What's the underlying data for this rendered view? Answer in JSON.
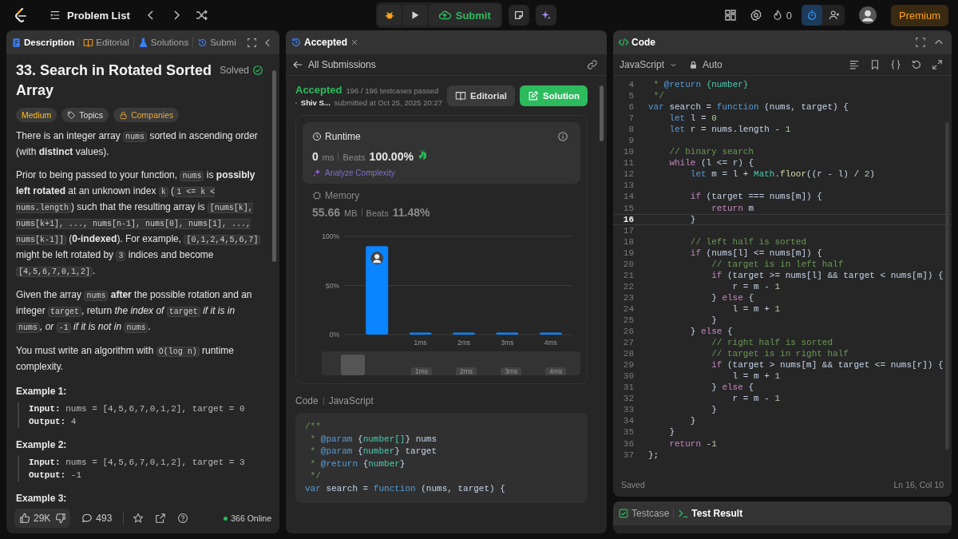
{
  "top_bar": {
    "problem_list": "Problem List",
    "submit": "Submit",
    "fire_count": "0",
    "premium": "Premium"
  },
  "description_panel": {
    "tabs": [
      {
        "label": "Description",
        "selected": true
      },
      {
        "label": "Editorial",
        "selected": false
      },
      {
        "label": "Solutions",
        "selected": false
      },
      {
        "label": "Submi",
        "selected": false
      }
    ],
    "title": "33. Search in Rotated Sorted Array",
    "status": "Solved",
    "tags": [
      {
        "label": "Medium",
        "kind": "difficulty"
      },
      {
        "label": "Topics",
        "kind": "topic"
      },
      {
        "label": "Companies",
        "kind": "company"
      }
    ],
    "paragraphs": [
      [
        {
          "kind": "text",
          "text": "There is an integer array "
        },
        {
          "kind": "code",
          "text": "nums"
        },
        {
          "kind": "text",
          "text": " sorted in ascending order (with **distinct** values)."
        }
      ],
      [
        {
          "kind": "text",
          "text": "Prior to being passed to your function, "
        },
        {
          "kind": "code",
          "text": "nums"
        },
        {
          "kind": "text",
          "text": " is **possibly left rotated** at an unknown index "
        },
        {
          "kind": "code",
          "text": "k"
        },
        {
          "kind": "text",
          "text": " ("
        },
        {
          "kind": "code",
          "text": "1 <= k < nums.length"
        },
        {
          "kind": "text",
          "text": ") such that the resulting array is "
        },
        {
          "kind": "code",
          "text": "[nums[k], nums[k+1], ..., nums[n-1], nums[0], nums[1], ..., nums[k-1]]"
        },
        {
          "kind": "text",
          "text": " (**0-indexed**). For example, "
        },
        {
          "kind": "code",
          "text": "[0,1,2,4,5,6,7]"
        },
        {
          "kind": "text",
          "text": " might be left rotated by "
        },
        {
          "kind": "code",
          "text": "3"
        },
        {
          "kind": "text",
          "text": " indices and become "
        },
        {
          "kind": "code",
          "text": "[4,5,6,7,0,1,2]"
        },
        {
          "kind": "text",
          "text": "."
        }
      ],
      [
        {
          "kind": "text",
          "text": "Given the array "
        },
        {
          "kind": "code",
          "text": "nums"
        },
        {
          "kind": "text",
          "text": " **after** the possible rotation and an integer "
        },
        {
          "kind": "code",
          "text": "target"
        },
        {
          "kind": "text",
          "text": ", return *the index of* "
        },
        {
          "kind": "code",
          "text": "target"
        },
        {
          "kind": "text",
          "text": " *if it is in* "
        },
        {
          "kind": "code",
          "text": "nums"
        },
        {
          "kind": "text",
          "text": "*, or* "
        },
        {
          "kind": "code",
          "text": "-1"
        },
        {
          "kind": "text",
          "text": " *if it is not in* "
        },
        {
          "kind": "code",
          "text": "nums"
        },
        {
          "kind": "text",
          "text": "."
        }
      ],
      [
        {
          "kind": "text",
          "text": "You must write an algorithm with "
        },
        {
          "kind": "code",
          "text": "O(log n)"
        },
        {
          "kind": "text",
          "text": " runtime complexity."
        }
      ]
    ],
    "examples": [
      {
        "title": "Example 1:",
        "lines": [
          {
            "label": "Input:",
            "value": "nums = [4,5,6,7,0,1,2], target = 0"
          },
          {
            "label": "Output:",
            "value": "4"
          }
        ]
      },
      {
        "title": "Example 2:",
        "lines": [
          {
            "label": "Input:",
            "value": "nums = [4,5,6,7,0,1,2], target = 3"
          },
          {
            "label": "Output:",
            "value": "-1"
          }
        ]
      },
      {
        "title": "Example 3:"
      }
    ],
    "footer": {
      "likes": "29K",
      "comments": "493",
      "online": "366 Online"
    }
  },
  "submission_panel": {
    "tab": "Accepted",
    "back": "All Submissions",
    "status": "Accepted",
    "testcases": "196 / 196 testcases passed",
    "user": "Shiv S...",
    "submitted": "submitted at Oct 25, 2025 20:27",
    "buttons": [
      {
        "label": "Editorial",
        "kind": "secondary"
      },
      {
        "label": "Solution",
        "kind": "primary"
      }
    ],
    "runtime": {
      "title": "Runtime",
      "value": "0",
      "unit": "ms",
      "beats_label": "Beats",
      "beats": "100.00%",
      "analyze": "Analyze Complexity",
      "selected": true
    },
    "memory": {
      "title": "Memory",
      "value": "55.66",
      "unit": "MB",
      "beats_label": "Beats",
      "beats": "11.48%",
      "selected": false
    },
    "chart_data": {
      "type": "bar",
      "categories": [
        null,
        "1ms",
        "2ms",
        "3ms",
        "4ms"
      ],
      "values": [
        90,
        2,
        2,
        2,
        2
      ],
      "ylim": [
        0,
        100
      ],
      "yticks": [
        {
          "value": 0,
          "label": "0%"
        },
        {
          "value": 50,
          "label": "50%"
        },
        {
          "value": 100,
          "label": "100%"
        }
      ]
    },
    "navigator": {
      "labels": [
        "1ms",
        "2ms",
        "3ms",
        "4ms"
      ]
    },
    "code_label": "Code",
    "language": "JavaScript",
    "code": [
      {
        "tokens": [
          {
            "text": "/**",
            "kind": "cm"
          }
        ]
      },
      {
        "tokens": [
          {
            "text": " * ",
            "kind": "cm"
          },
          {
            "text": "@param",
            "kind": "doc"
          },
          {
            "text": " {"
          },
          {
            "text": "number[]",
            "kind": "type"
          },
          {
            "text": "} nums"
          }
        ]
      },
      {
        "tokens": [
          {
            "text": " * ",
            "kind": "cm"
          },
          {
            "text": "@param",
            "kind": "doc"
          },
          {
            "text": " {"
          },
          {
            "text": "number",
            "kind": "type"
          },
          {
            "text": "} target"
          }
        ]
      },
      {
        "tokens": [
          {
            "text": " * ",
            "kind": "cm"
          },
          {
            "text": "@return",
            "kind": "doc"
          },
          {
            "text": " {"
          },
          {
            "text": "number",
            "kind": "type"
          },
          {
            "text": "}"
          }
        ]
      },
      {
        "tokens": [
          {
            "text": " */",
            "kind": "cm"
          }
        ]
      },
      {
        "tokens": [
          {
            "text": "var",
            "kind": "kw"
          },
          {
            "text": " search = "
          },
          {
            "text": "function",
            "kind": "kw"
          },
          {
            "text": " (nums, target) {"
          }
        ]
      }
    ]
  },
  "editor": {
    "title": "Code",
    "language": "JavaScript",
    "mode": "Auto",
    "status": "Saved",
    "cursor": "Ln 16, Col 10",
    "lines": [
      {
        "number": "4",
        "active": false,
        "tokens": [
          {
            "text": " * ",
            "kind": "cm"
          },
          {
            "text": "@return",
            "kind": "doc"
          },
          {
            "text": " {number}",
            "kind": "type"
          }
        ]
      },
      {
        "number": "5",
        "active": false,
        "tokens": [
          {
            "text": " */",
            "kind": "cm"
          }
        ]
      },
      {
        "number": "6",
        "active": false,
        "tokens": [
          {
            "text": "var",
            "kind": "kw"
          },
          {
            "text": " search = "
          },
          {
            "text": "function",
            "kind": "kw"
          },
          {
            "text": " (nums, target) {"
          }
        ]
      },
      {
        "number": "7",
        "active": false,
        "tokens": [
          {
            "text": "    let",
            "kind": "kw"
          },
          {
            "text": " l = "
          },
          {
            "text": "0",
            "kind": "num"
          }
        ]
      },
      {
        "number": "8",
        "active": false,
        "tokens": [
          {
            "text": "    let",
            "kind": "kw"
          },
          {
            "text": " r = nums.length - "
          },
          {
            "text": "1",
            "kind": "num"
          }
        ]
      },
      {
        "number": "9",
        "active": false
      },
      {
        "number": "10",
        "active": false,
        "tokens": [
          {
            "text": "    // binary search",
            "kind": "cm"
          }
        ]
      },
      {
        "number": "11",
        "active": false,
        "tokens": [
          {
            "text": "    while",
            "kind": "ctl"
          },
          {
            "text": " (l <= r) {"
          }
        ]
      },
      {
        "number": "12",
        "active": false,
        "tokens": [
          {
            "text": "        let",
            "kind": "kw"
          },
          {
            "text": " m = l + "
          },
          {
            "text": "Math",
            "kind": "cls"
          },
          {
            "text": "."
          },
          {
            "text": "floor",
            "kind": "fn"
          },
          {
            "text": "((r - l) / "
          },
          {
            "text": "2",
            "kind": "num"
          },
          {
            "text": ")"
          }
        ]
      },
      {
        "number": "13",
        "active": false
      },
      {
        "number": "14",
        "active": false,
        "tokens": [
          {
            "text": "        if",
            "kind": "ctl"
          },
          {
            "text": " (target === nums[m]) {"
          }
        ]
      },
      {
        "number": "15",
        "active": false,
        "tokens": [
          {
            "text": "            return",
            "kind": "ctl"
          },
          {
            "text": " m"
          }
        ]
      },
      {
        "number": "16",
        "active": true,
        "tokens": [
          {
            "text": "        }"
          }
        ]
      },
      {
        "number": "17",
        "active": false
      },
      {
        "number": "18",
        "active": false,
        "tokens": [
          {
            "text": "        // left half is sorted",
            "kind": "cm"
          }
        ]
      },
      {
        "number": "19",
        "active": false,
        "tokens": [
          {
            "text": "        if",
            "kind": "ctl"
          },
          {
            "text": " (nums[l] <= nums[m]) {"
          }
        ]
      },
      {
        "number": "20",
        "active": false,
        "tokens": [
          {
            "text": "            // target is in left half",
            "kind": "cm"
          }
        ]
      },
      {
        "number": "21",
        "active": false,
        "tokens": [
          {
            "text": "            if",
            "kind": "ctl"
          },
          {
            "text": " (target >= nums[l] && target < nums[m]) {"
          }
        ]
      },
      {
        "number": "22",
        "active": false,
        "tokens": [
          {
            "text": "                r = m - "
          },
          {
            "text": "1",
            "kind": "num"
          }
        ]
      },
      {
        "number": "23",
        "active": false,
        "tokens": [
          {
            "text": "            } "
          },
          {
            "text": "else",
            "kind": "ctl"
          },
          {
            "text": " {"
          }
        ]
      },
      {
        "number": "24",
        "active": false,
        "tokens": [
          {
            "text": "                l = m + "
          },
          {
            "text": "1",
            "kind": "num"
          }
        ]
      },
      {
        "number": "25",
        "active": false,
        "tokens": [
          {
            "text": "            }"
          }
        ]
      },
      {
        "number": "26",
        "active": false,
        "tokens": [
          {
            "text": "        } "
          },
          {
            "text": "else",
            "kind": "ctl"
          },
          {
            "text": " {"
          }
        ]
      },
      {
        "number": "27",
        "active": false,
        "tokens": [
          {
            "text": "            // right half is sorted",
            "kind": "cm"
          }
        ]
      },
      {
        "number": "28",
        "active": false,
        "tokens": [
          {
            "text": "            // target is in right half",
            "kind": "cm"
          }
        ]
      },
      {
        "number": "29",
        "active": false,
        "tokens": [
          {
            "text": "            if",
            "kind": "ctl"
          },
          {
            "text": " (target > nums[m] && target <= nums[r]) {"
          }
        ]
      },
      {
        "number": "30",
        "active": false,
        "tokens": [
          {
            "text": "                l = m + "
          },
          {
            "text": "1",
            "kind": "num"
          }
        ]
      },
      {
        "number": "31",
        "active": false,
        "tokens": [
          {
            "text": "            } "
          },
          {
            "text": "else",
            "kind": "ctl"
          },
          {
            "text": " {"
          }
        ]
      },
      {
        "number": "32",
        "active": false,
        "tokens": [
          {
            "text": "                r = m - "
          },
          {
            "text": "1",
            "kind": "num"
          }
        ]
      },
      {
        "number": "33",
        "active": false,
        "tokens": [
          {
            "text": "            }"
          }
        ]
      },
      {
        "number": "34",
        "active": false,
        "tokens": [
          {
            "text": "        }"
          }
        ]
      },
      {
        "number": "35",
        "active": false,
        "tokens": [
          {
            "text": "    }"
          }
        ]
      },
      {
        "number": "36",
        "active": false,
        "tokens": [
          {
            "text": "    return",
            "kind": "ctl"
          },
          {
            "text": " -"
          },
          {
            "text": "1",
            "kind": "num"
          }
        ]
      },
      {
        "number": "37",
        "active": false,
        "tokens": [
          {
            "text": "};"
          }
        ]
      }
    ]
  },
  "test_panel": {
    "tabs": [
      {
        "label": "Testcase",
        "selected": false
      },
      {
        "label": "Test Result",
        "selected": true
      }
    ]
  }
}
